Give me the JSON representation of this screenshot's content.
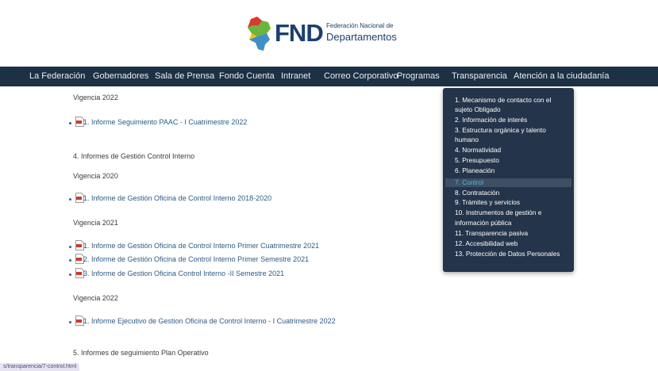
{
  "logo": {
    "brand": "FND",
    "subtitle_line1": "Federación Nacional de",
    "subtitle_line2": "Departamentos"
  },
  "nav": {
    "items": [
      "La Federación",
      "Gobernadores",
      "Sala de Prensa",
      "Fondo Cuenta",
      "Intranet",
      "Correo Corporativo",
      "Programas",
      "Transparencia",
      "Atención a la ciudadanía"
    ]
  },
  "content": {
    "h_vigencia_2022_a": "Vigencia 2022",
    "link_paac": "1. Informe Seguimiento PAAC - I Cuatrimestre 2022",
    "section_4": "4. Informes de Gestión Control Interno",
    "h_vigencia_2020": "Vigencia 2020",
    "link_2018_2020": "1. Informe de Gestión Oficina de Control Interno 2018-2020",
    "h_vigencia_2021": "Vigencia 2021",
    "link_2021_1": "1. Informe de Gestión Oficina de Control Interno Primer Cuatrimestre 2021",
    "link_2021_2": "2. Informe de Gestión Oficina de Control Interno Primer Semestre 2021",
    "link_2021_3": "3. Informe de Gestion Oficina Control Interno -II Semestre 2021",
    "h_vigencia_2022_b": "Vigencia 2022",
    "link_2022_exec": "1. Informe Ejecutivo de Gestion Oficina de Control Interno - I Cuatrimestre 2022",
    "section_5": "5. Informes de seguimiento Plan Operativo"
  },
  "dropdown": {
    "lines": [
      "1. Mecanismo de contacto con el",
      "sujeto Obligado",
      "2. Información de interés",
      "3. Estructura orgánica y talento",
      "humano",
      "4. Normatividad",
      "5. Presupuesto",
      "6. Planeación",
      "7. Control",
      "8. Contratación",
      "9. Trámites y servicios",
      "10. Instrumentos de gestión e",
      "información pública",
      "11. Transparencia pasiva",
      "12. Accesibilidad web",
      "13. Protección de Datos Personales"
    ],
    "active_color": "#4fb6e8"
  },
  "status": {
    "url": "s/transparencia/7-control.html"
  },
  "colors": {
    "nav_bg": "#1d3145",
    "dropdown_bg": "#24344a",
    "link": "#2d5a86"
  }
}
